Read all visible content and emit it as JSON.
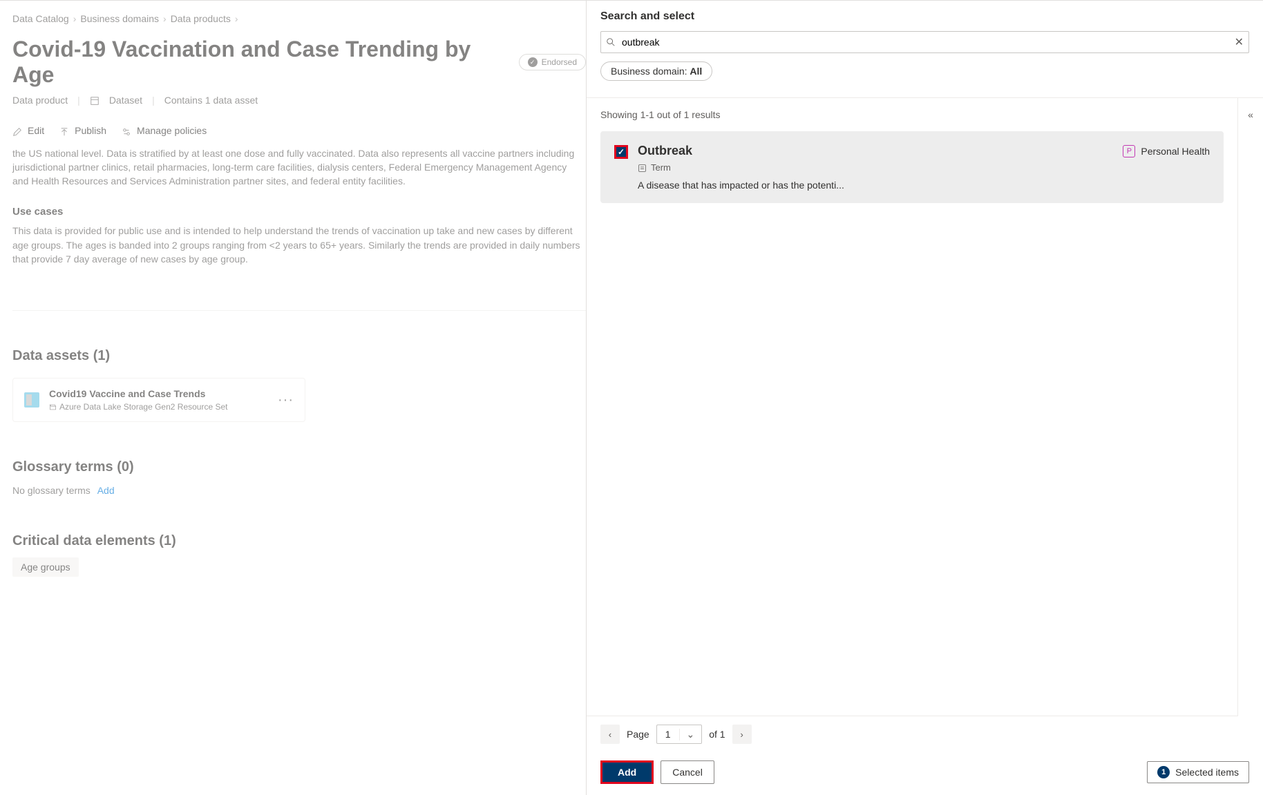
{
  "breadcrumb": {
    "items": [
      "Data Catalog",
      "Business domains",
      "Data products"
    ]
  },
  "page": {
    "title": "Covid-19 Vaccination and Case Trending by Age",
    "endorsed_label": "Endorsed",
    "meta_type": "Data product",
    "meta_kind": "Dataset",
    "meta_count": "Contains 1 data asset"
  },
  "actions": {
    "edit": "Edit",
    "publish": "Publish",
    "manage_policies": "Manage policies"
  },
  "body": {
    "para1": "the US national level. Data is stratified by at least one dose and fully vaccinated. Data also represents all vaccine partners including jurisdictional partner clinics, retail pharmacies, long-term care facilities, dialysis centers, Federal Emergency Management Agency and Health Resources and Services Administration partner sites, and federal entity facilities.",
    "usecases_heading": "Use cases",
    "para2": "This data is provided for public use and is intended to help understand the trends of vaccination up take and new cases by different age groups.  The ages is banded into 2 groups ranging from <2 years to 65+ years.  Similarly the trends are provided in daily numbers that provide 7 day average of new cases by age group."
  },
  "data_assets": {
    "heading": "Data assets (1)",
    "card": {
      "name": "Covid19 Vaccine and Case Trends",
      "subtype": "Azure Data Lake Storage Gen2 Resource Set"
    }
  },
  "glossary": {
    "heading": "Glossary terms (0)",
    "empty": "No glossary terms",
    "add": "Add"
  },
  "critical": {
    "heading": "Critical data elements (1)",
    "chip": "Age groups"
  },
  "panel": {
    "title": "Search and select",
    "search_value": "outbreak",
    "filter_prefix": "Business domain: ",
    "filter_value": "All",
    "results_count": "Showing 1-1 out of 1 results",
    "result": {
      "title": "Outbreak",
      "tag_letter": "P",
      "tag_label": "Personal Health",
      "type": "Term",
      "desc": "A disease that has impacted or has the potenti..."
    },
    "pager": {
      "label": "Page",
      "current": "1",
      "of": "of 1"
    },
    "footer": {
      "add": "Add",
      "cancel": "Cancel",
      "selected_count": "1",
      "selected_label": "Selected items"
    }
  }
}
